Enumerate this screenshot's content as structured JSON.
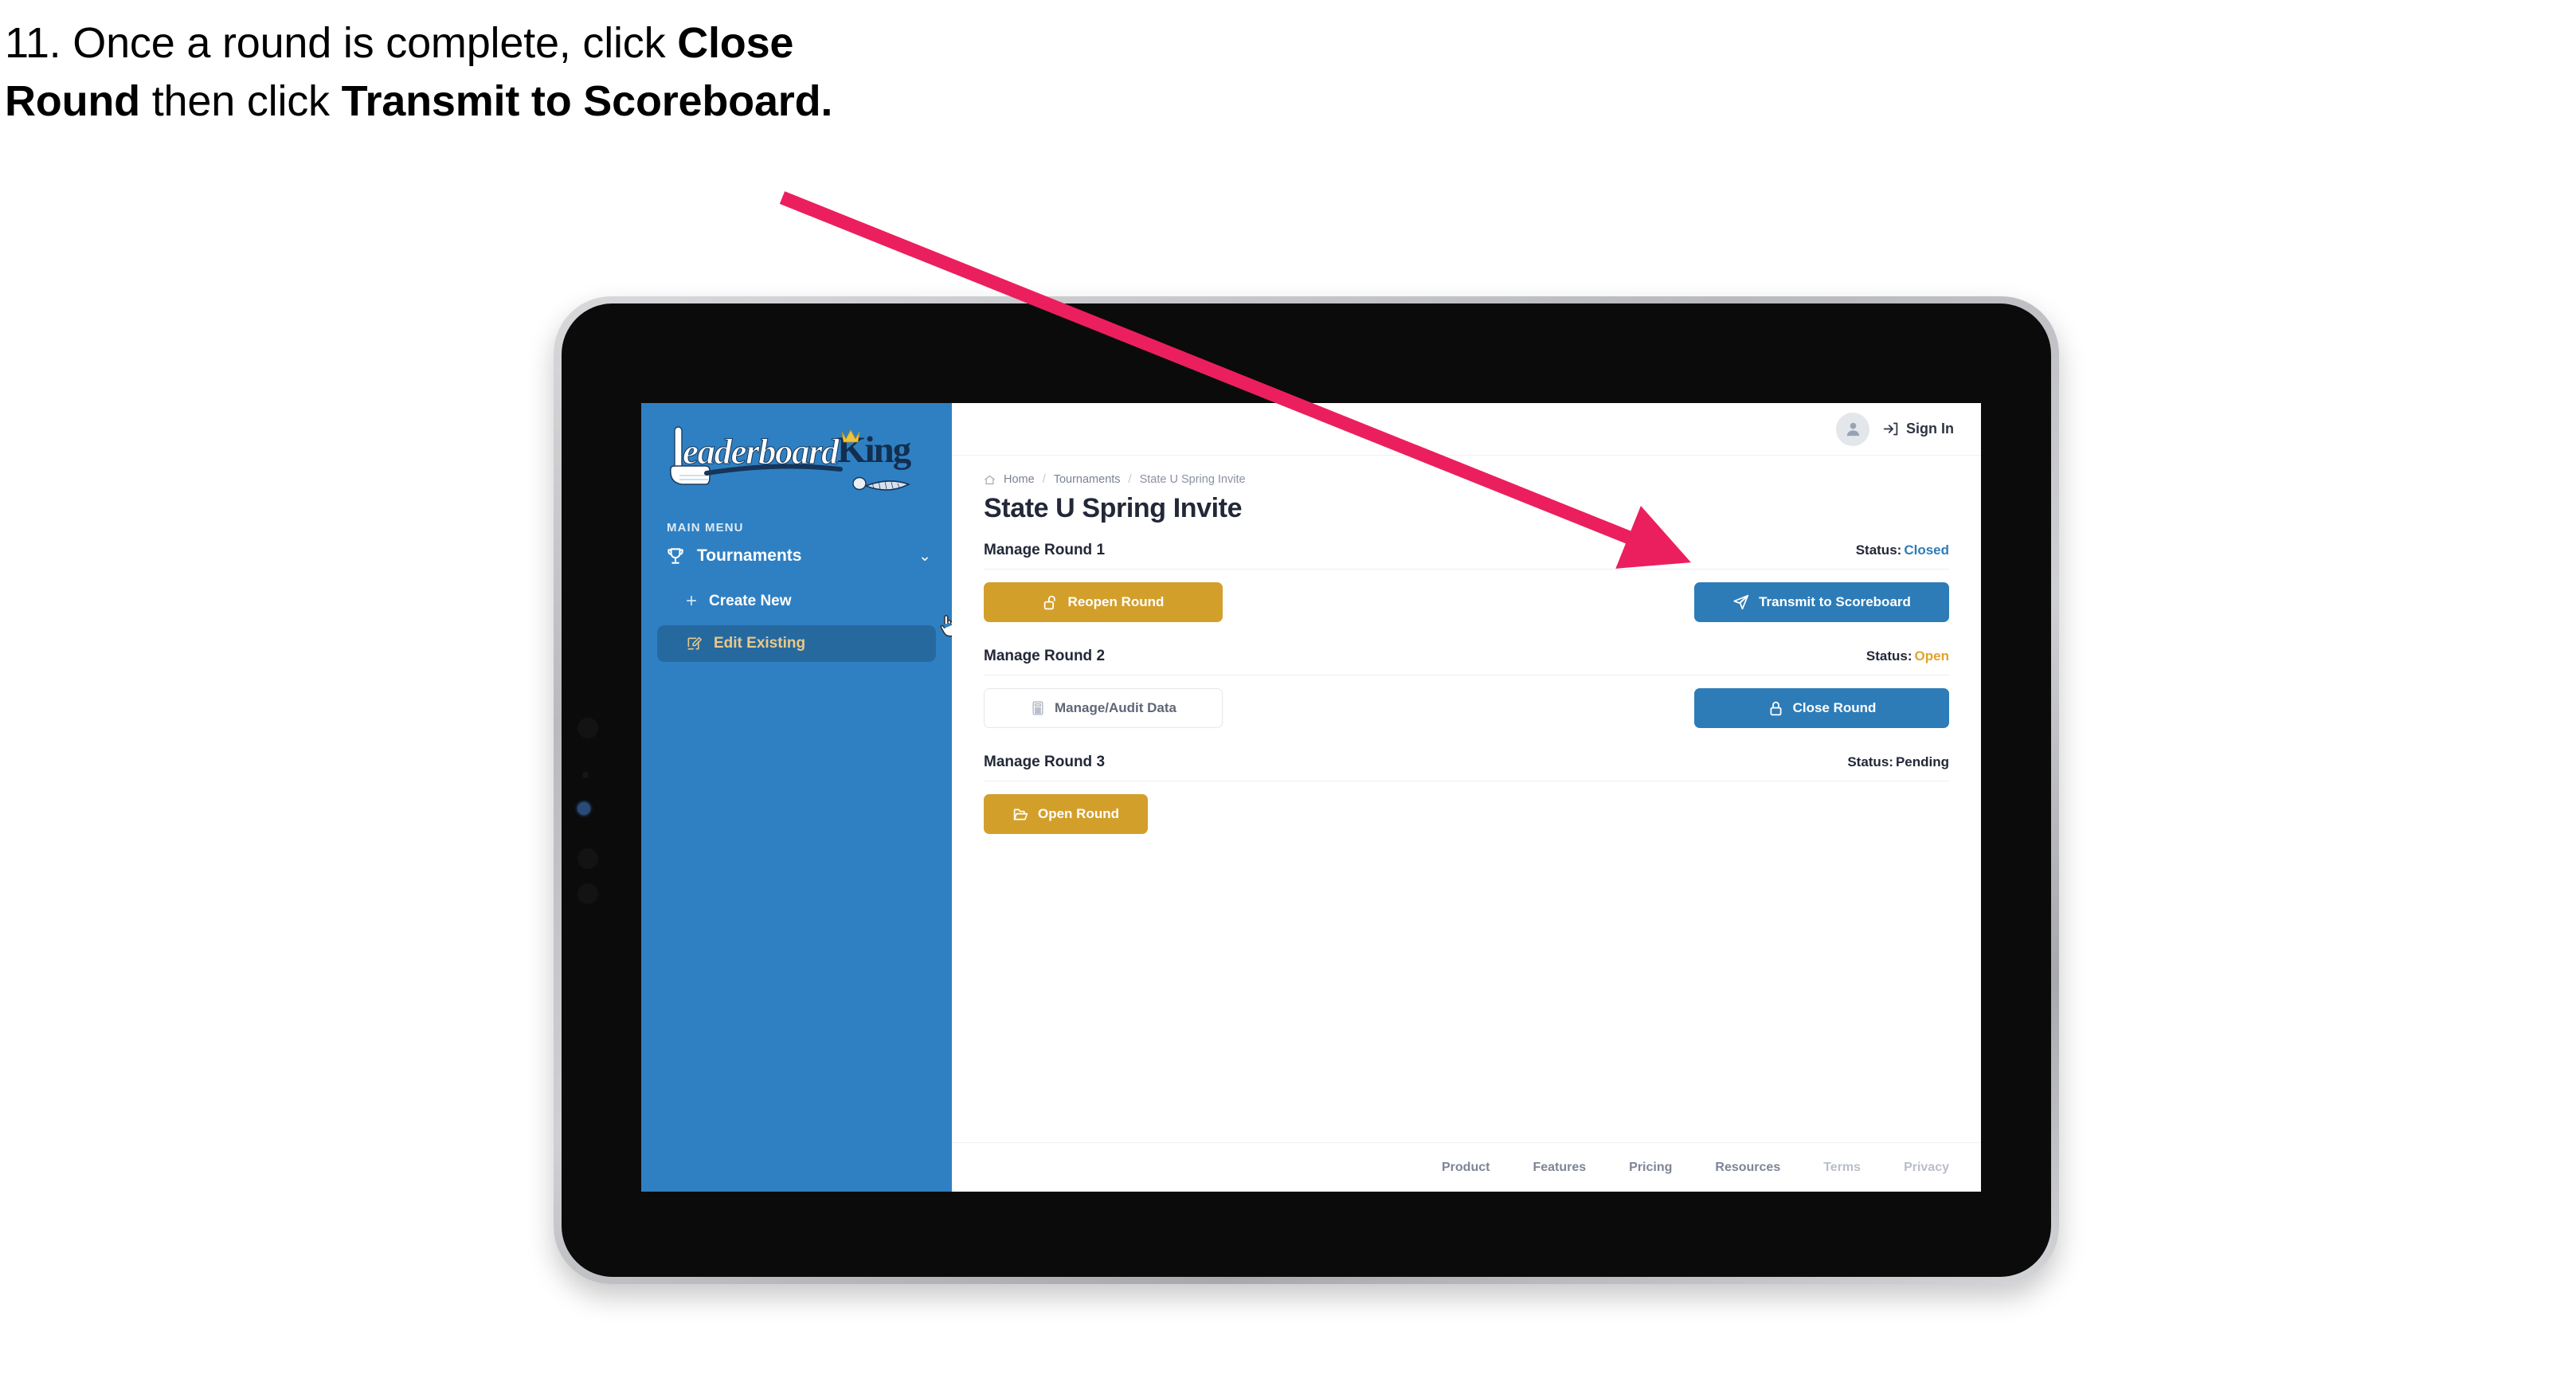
{
  "caption": {
    "prefix": "11. Once a round is complete, click ",
    "bold1": "Close Round",
    "middle": " then click ",
    "bold2": "Transmit to Scoreboard.",
    "arrow_color": "#ec1f5e"
  },
  "app": {
    "logo_primary": "Leaderboard",
    "logo_secondary": "King"
  },
  "sidebar": {
    "section_label": "MAIN MENU",
    "nav": {
      "label": "Tournaments",
      "chevron": "⌄"
    },
    "items": [
      {
        "label": "Create New",
        "icon": "plus-icon",
        "active": false
      },
      {
        "label": "Edit Existing",
        "icon": "edit-pencil-icon",
        "active": true
      }
    ],
    "bg_color": "#2f80c2",
    "active_bg": "#26699f",
    "active_text": "#e9c98a"
  },
  "topbar": {
    "avatar_icon": "user-avatar-icon",
    "sign_in_label": "Sign In",
    "sign_in_icon": "sign-in-arrow-icon"
  },
  "breadcrumb": {
    "home_icon": "home-icon",
    "items": [
      "Home",
      "Tournaments",
      "State U Spring Invite"
    ],
    "separator": "/"
  },
  "page": {
    "title": "State U Spring Invite"
  },
  "rounds": [
    {
      "title": "Manage Round 1",
      "status_label": "Status:",
      "status_value": "Closed",
      "status_color": "#2d7cb8",
      "left_button": {
        "label": "Reopen Round",
        "icon": "unlock-icon",
        "style": "gold"
      },
      "right_button": {
        "label": "Transmit to Scoreboard",
        "icon": "paper-plane-icon",
        "style": "blue"
      }
    },
    {
      "title": "Manage Round 2",
      "status_label": "Status:",
      "status_value": "Open",
      "status_color": "#e0a42c",
      "left_button": {
        "label": "Manage/Audit Data",
        "icon": "calculator-icon",
        "style": "ghost"
      },
      "right_button": {
        "label": "Close Round",
        "icon": "lock-icon",
        "style": "blue"
      }
    },
    {
      "title": "Manage Round 3",
      "status_label": "Status:",
      "status_value": "Pending",
      "status_color": "#232838",
      "left_button": {
        "label": "Open Round",
        "icon": "open-folder-icon",
        "style": "gold"
      },
      "right_button": null
    }
  ],
  "footer": {
    "links": [
      {
        "label": "Product",
        "dim": false
      },
      {
        "label": "Features",
        "dim": false
      },
      {
        "label": "Pricing",
        "dim": false
      },
      {
        "label": "Resources",
        "dim": false
      },
      {
        "label": "Terms",
        "dim": true
      },
      {
        "label": "Privacy",
        "dim": true
      }
    ]
  }
}
